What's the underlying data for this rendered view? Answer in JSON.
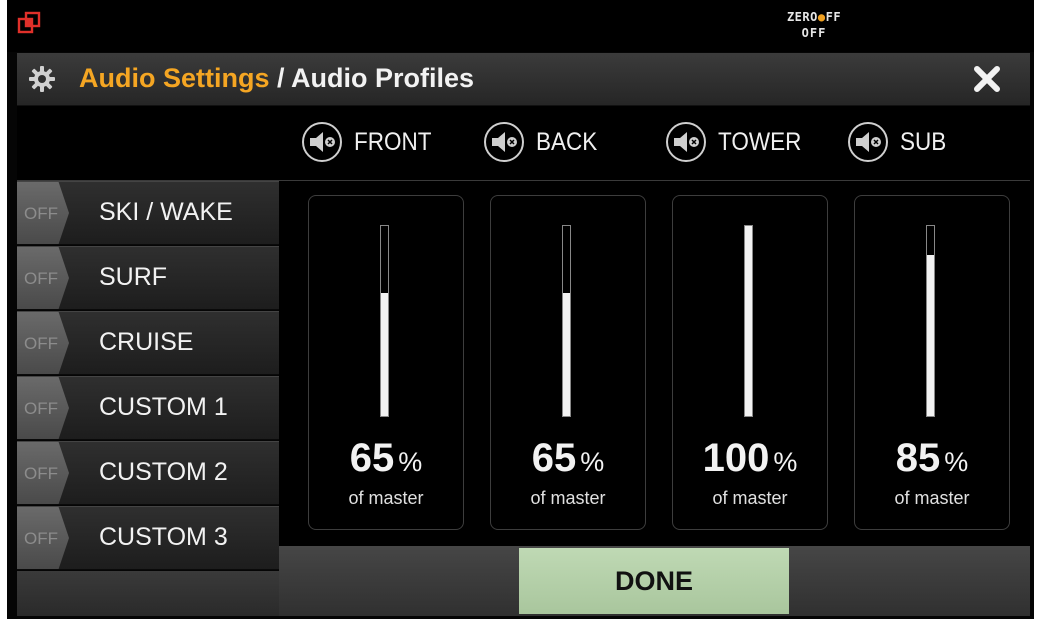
{
  "status_bar": {
    "app_icon": "window-restore-icon",
    "brand": {
      "prefix": "ZERO",
      "dot": "●",
      "suffix": "FF"
    },
    "state": "OFF"
  },
  "header": {
    "icon": "gear-icon",
    "breadcrumb": "Audio Settings",
    "separator": " / ",
    "current": "Audio Profiles",
    "close_icon": "close-icon"
  },
  "zones": [
    {
      "label": "FRONT",
      "icon": "speaker-muted-icon",
      "level": 65
    },
    {
      "label": "BACK",
      "icon": "speaker-muted-icon",
      "level": 65
    },
    {
      "label": "TOWER",
      "icon": "speaker-muted-icon",
      "level": 100
    },
    {
      "label": "SUB",
      "icon": "speaker-muted-icon",
      "level": 85
    }
  ],
  "level_unit": "%",
  "level_caption": "of master",
  "profiles": [
    {
      "name": "SKI / WAKE",
      "toggle": "OFF",
      "selected": true
    },
    {
      "name": "SURF",
      "toggle": "OFF",
      "selected": false
    },
    {
      "name": "CRUISE",
      "toggle": "OFF",
      "selected": false
    },
    {
      "name": "CUSTOM 1",
      "toggle": "OFF",
      "selected": false
    },
    {
      "name": "CUSTOM 2",
      "toggle": "OFF",
      "selected": false
    },
    {
      "name": "CUSTOM 3",
      "toggle": "OFF",
      "selected": false
    }
  ],
  "done_label": "DONE",
  "colors": {
    "accent": "#f5a623",
    "selected_border": "#69c43a",
    "done_bg": "#b5d0a9"
  }
}
